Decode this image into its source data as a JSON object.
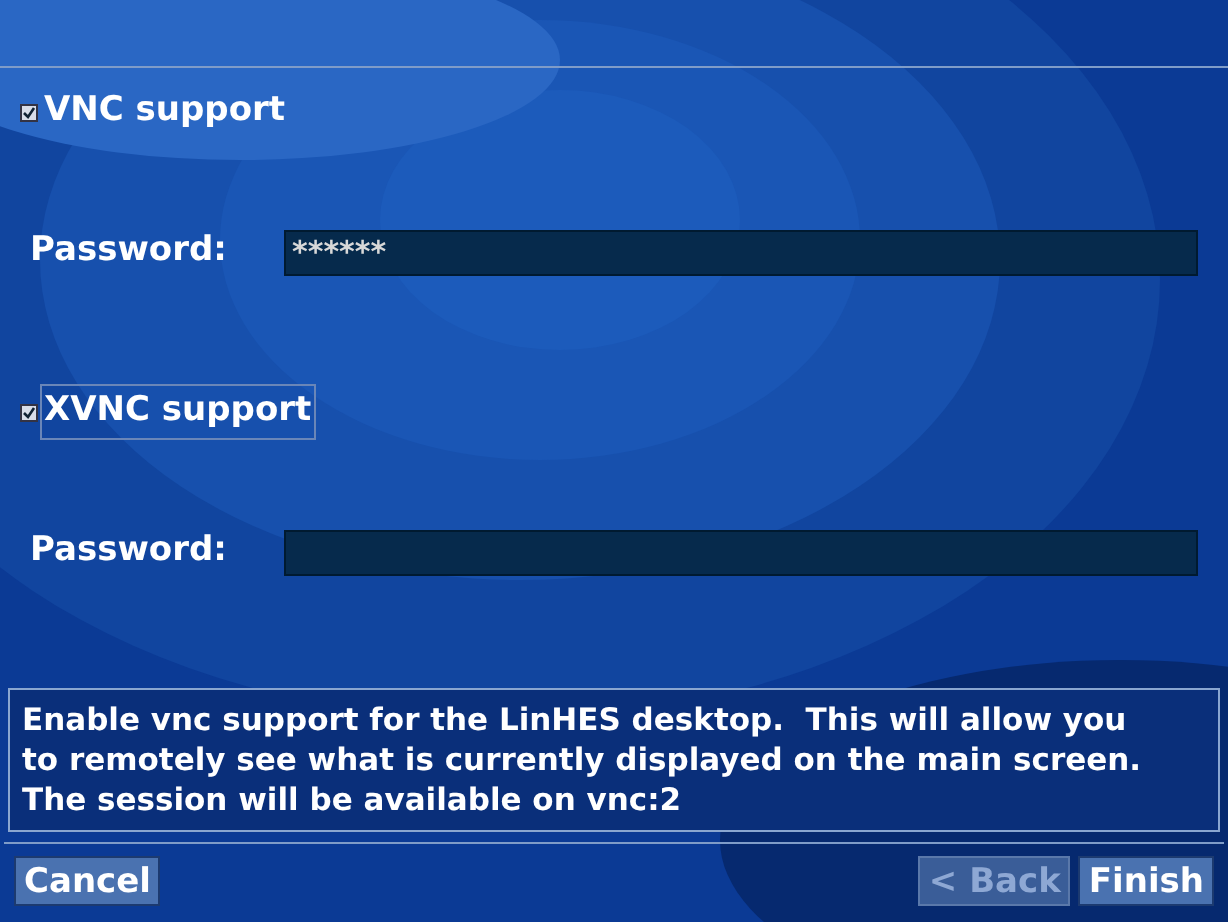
{
  "settings": [
    {
      "kind": "checkbox",
      "label": "VNC support",
      "checked": true,
      "focused": false
    },
    {
      "kind": "password",
      "label": "Password:",
      "value": "******"
    },
    {
      "kind": "checkbox",
      "label": "XVNC support",
      "checked": true,
      "focused": true
    },
    {
      "kind": "password",
      "label": "Password:"
    }
  ],
  "help_text": "Enable vnc support for the LinHES desktop.  This will allow you to remotely see what is currently displayed on the main screen.  The session will be available on vnc:2",
  "left_buttons": [
    {
      "label": "Cancel",
      "disabled": false
    }
  ],
  "right_buttons": [
    {
      "label": "< Back",
      "disabled": true
    },
    {
      "label": "Finish",
      "disabled": false
    }
  ]
}
